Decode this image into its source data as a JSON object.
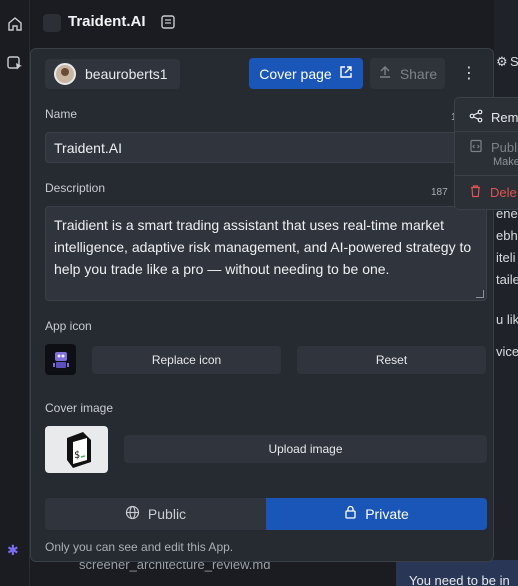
{
  "topbar": {
    "title": "Traident.AI",
    "home_icon": "home-icon",
    "notes_icon": "notes-icon"
  },
  "colors": {
    "primary": "#1a56b8",
    "panel_bg": "#262a31",
    "danger": "#e0534f"
  },
  "panel": {
    "owner": {
      "name": "beauroberts1"
    },
    "cover_page_label": "Cover page",
    "share_label": "Share",
    "name_label": "Name",
    "name_count": "1",
    "name_value": "Traident.AI",
    "description_label": "Description",
    "description_count": "187",
    "description_value": "Traidient is a smart trading assistant that uses real-time market intelligence, adaptive risk management, and AI-powered strategy to help you trade like a pro — without needing to be one.",
    "app_icon_label": "App icon",
    "replace_icon_label": "Replace icon",
    "reset_label": "Reset",
    "cover_image_label": "Cover image",
    "upload_image_label": "Upload image",
    "visibility": {
      "public_label": "Public",
      "private_label": "Private",
      "selected": "Private"
    },
    "hint": "Only you can see and edit this App."
  },
  "menu": {
    "remix_label": "Rem",
    "publish_label": "Publi",
    "publish_sub": "Make",
    "delete_label": "Dele"
  },
  "background": {
    "right_lines": [
      "ene",
      "ebho",
      "iteli",
      "taile",
      "u lik",
      "vice"
    ],
    "right_top": "S",
    "file_name": "screener_architecture_review.md",
    "bottom_banner": "You need to be in"
  }
}
